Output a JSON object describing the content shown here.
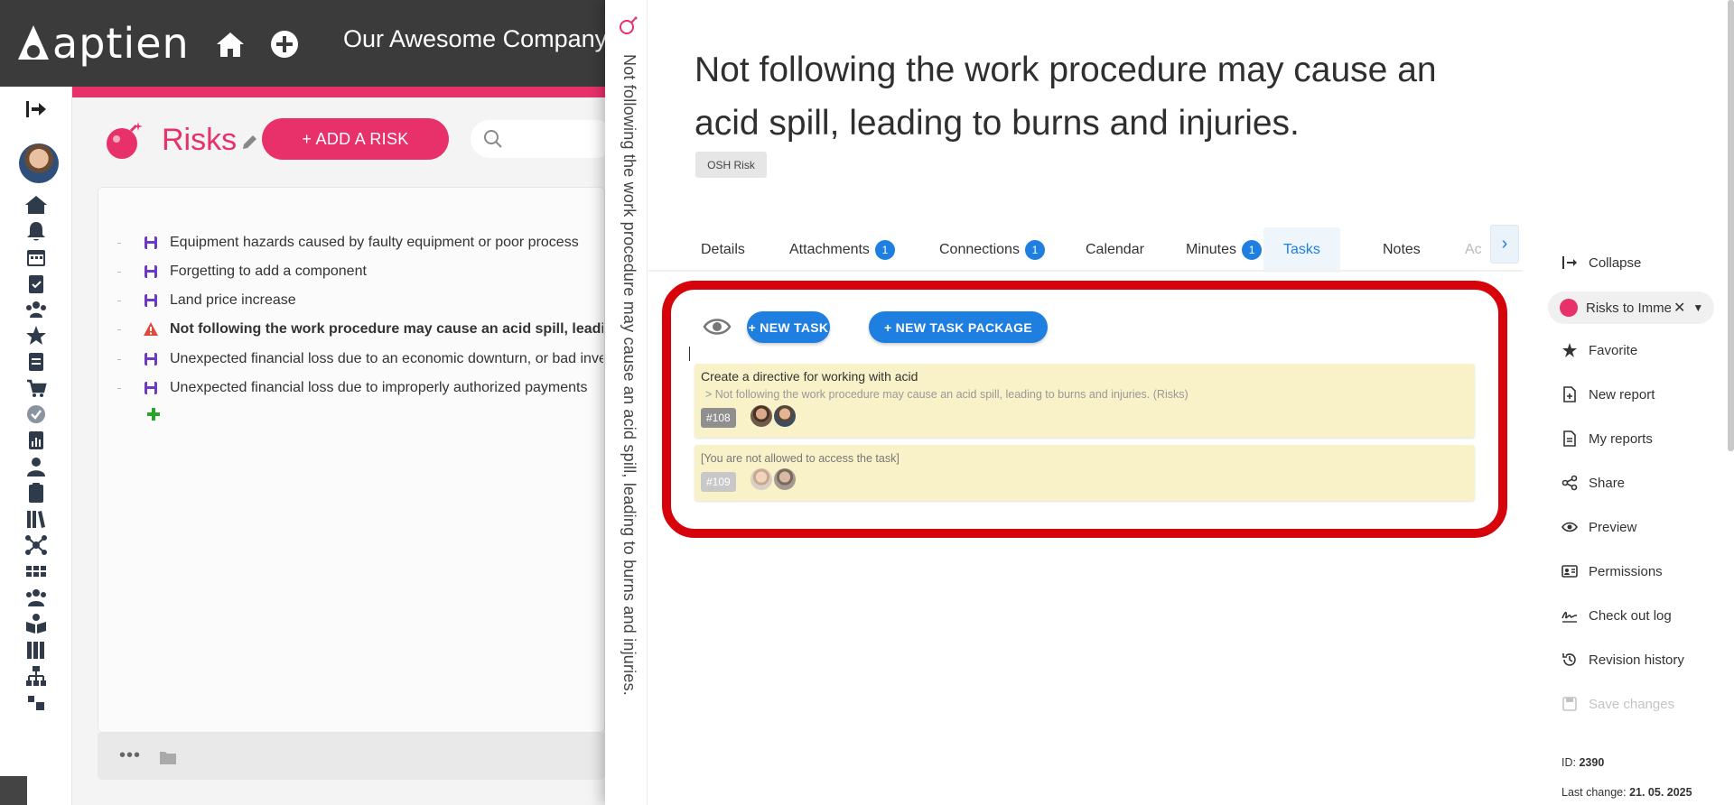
{
  "header": {
    "logo_text": "aptien",
    "company": "Our Awesome Company"
  },
  "risks_page": {
    "title": "Risks",
    "add_button": "+ ADD A RISK",
    "items": [
      {
        "label": "Equipment hazards caused by faulty equipment or poor process",
        "icon": "floppy-icon",
        "active": false
      },
      {
        "label": "Forgetting to add a component",
        "icon": "floppy-icon",
        "active": false
      },
      {
        "label": "Land price increase",
        "icon": "floppy-icon",
        "active": false
      },
      {
        "label": "Not following the work procedure may cause an acid spill, leading to burns",
        "icon": "warning-icon",
        "active": true
      },
      {
        "label": "Unexpected financial loss due to an economic downturn, or bad investment",
        "icon": "floppy-icon",
        "active": false
      },
      {
        "label": "Unexpected financial loss due to improperly authorized payments",
        "icon": "floppy-icon",
        "active": false
      }
    ]
  },
  "detail": {
    "vertical_title": "Not following the work procedure may cause an acid spill, leading to burns and injuries.",
    "title": "Not following the work procedure may cause an acid spill, leading to burns and injuries.",
    "badge": "OSH Risk",
    "tabs": [
      {
        "label": "Details",
        "count": null
      },
      {
        "label": "Attachments",
        "count": "1"
      },
      {
        "label": "Connections",
        "count": "1"
      },
      {
        "label": "Calendar",
        "count": null
      },
      {
        "label": "Minutes",
        "count": "1"
      },
      {
        "label": "Tasks",
        "count": null
      },
      {
        "label": "Notes",
        "count": null
      },
      {
        "label": "Ac",
        "count": null
      }
    ],
    "active_tab": "Tasks",
    "buttons": {
      "new_task": "+ NEW TASK",
      "new_task_package": "+ NEW TASK PACKAGE"
    },
    "tasks": [
      {
        "title": "Create a directive for working with acid",
        "subtitle": "> Not following the work procedure may cause an acid spill, leading to burns and injuries. (Risks)",
        "number": "#108"
      },
      {
        "title": "[You are not allowed to access the task]",
        "subtitle": "",
        "number": "#109"
      }
    ]
  },
  "actions": {
    "collapse": "Collapse",
    "category": "Risks to Immediate",
    "favorite": "Favorite",
    "new_report": "New report",
    "my_reports": "My reports",
    "share": "Share",
    "preview": "Preview",
    "permissions": "Permissions",
    "check_out_log": "Check out log",
    "revision_history": "Revision history",
    "save_changes": "Save changes"
  },
  "meta": {
    "id_label": "ID:",
    "id_value": "2390",
    "last_change_label": "Last change:",
    "last_change_value": "21. 05. 2025"
  },
  "colors": {
    "brand_pink": "#e8316b",
    "accent_blue": "#1e7fe0",
    "highlight_red": "#d6040a",
    "task_card": "#f9f1c8",
    "topbar": "#3b3b3b"
  }
}
